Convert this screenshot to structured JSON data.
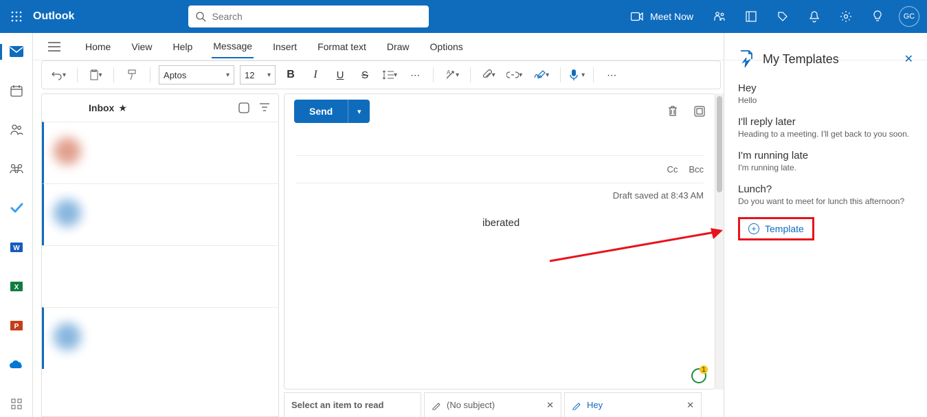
{
  "topbar": {
    "brand": "Outlook",
    "search_placeholder": "Search",
    "meet_now": "Meet Now",
    "avatar_initials": "GC"
  },
  "ribbon": {
    "tabs": [
      "Home",
      "View",
      "Help",
      "Message",
      "Insert",
      "Format text",
      "Draw",
      "Options"
    ],
    "active_index": 3
  },
  "toolbar": {
    "font_name": "Aptos",
    "font_size": "12"
  },
  "inbox": {
    "title": "Inbox"
  },
  "compose": {
    "send_label": "Send",
    "cc_label": "Cc",
    "bcc_label": "Bcc",
    "draft_status": "Draft saved at 8:43 AM",
    "body_visible_fragment": "iberated"
  },
  "bottom_tabs": {
    "reader": "Select an item to read",
    "tab1": "(No subject)",
    "tab2": "Hey"
  },
  "templates": {
    "pane_title": "My Templates",
    "items": [
      {
        "title": "Hey",
        "sub": "Hello"
      },
      {
        "title": "I'll reply later",
        "sub": "Heading to a meeting. I'll get back to you soon."
      },
      {
        "title": "I'm running late",
        "sub": "I'm running late."
      },
      {
        "title": "Lunch?",
        "sub": "Do you want to meet for lunch this afternoon?"
      }
    ],
    "add_label": "Template"
  }
}
